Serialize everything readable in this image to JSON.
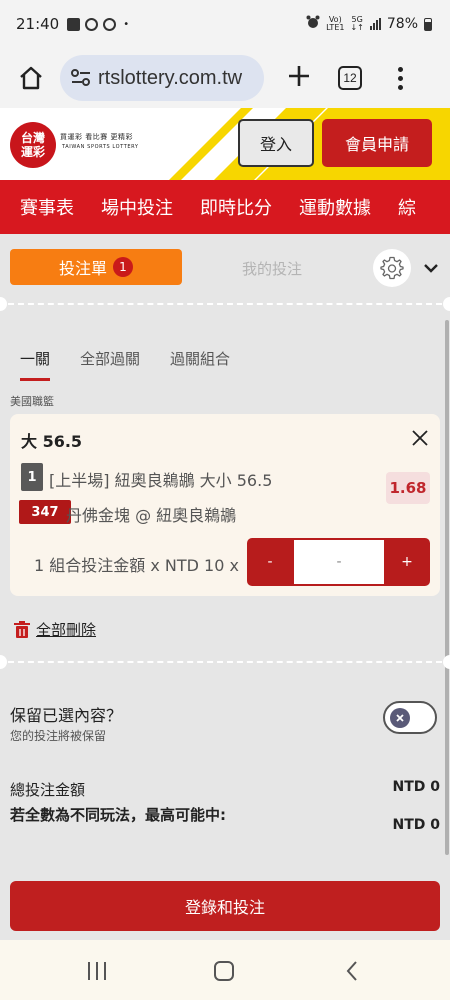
{
  "status_bar": {
    "time": "21:40",
    "dot": "•",
    "network_top": "Vo)",
    "network_bottom": "LTE1",
    "gen_top": "5G",
    "gen_bottom": "↓↑",
    "battery": "78%"
  },
  "browser": {
    "url": "rtslottery.com.tw",
    "tab_count": "12"
  },
  "header": {
    "logo_mark": "台灣\n運彩",
    "logo_tagline": "買運彩 看比賽 更精彩",
    "logo_english": "TAIWAN SPORTS LOTTERY",
    "login_label": "登入",
    "register_label": "會員申請"
  },
  "nav": {
    "items": [
      "賽事表",
      "場中投注",
      "即時比分",
      "運動數據",
      "綜"
    ]
  },
  "betslip": {
    "tab_label": "投注單",
    "count": "1",
    "my_bets_label": "我的投注",
    "bet_types": [
      "一關",
      "全部過關",
      "過關組合"
    ],
    "league": "美國職籃",
    "selection": {
      "title": "大 56.5",
      "leg_number": "1",
      "market": "[上半場] 紐奧良鵜鶘 大小 56.5",
      "event_code": "347",
      "match": "丹佛金塊 @ 紐奧良鵜鶘",
      "odds": "1.68"
    },
    "stake_label": "1 組合投注金額 x NTD 10 x",
    "stepper": {
      "minus": "-",
      "value": "-",
      "plus": "+"
    },
    "delete_all": "全部刪除",
    "keep_title": "保留已選內容？",
    "keep_subtitle": "您的投注將被保留",
    "total_label": "總投注金額",
    "total_value": "NTD 0",
    "max_win_label": "若全數為不同玩法，最高可能中:",
    "max_win_value": "NTD 0",
    "submit_label": "登錄和投注"
  },
  "colors": {
    "brand_red": "#d7181f",
    "orange": "#f77d12",
    "odds_red": "#c0262c",
    "yellow": "#f7d600"
  }
}
